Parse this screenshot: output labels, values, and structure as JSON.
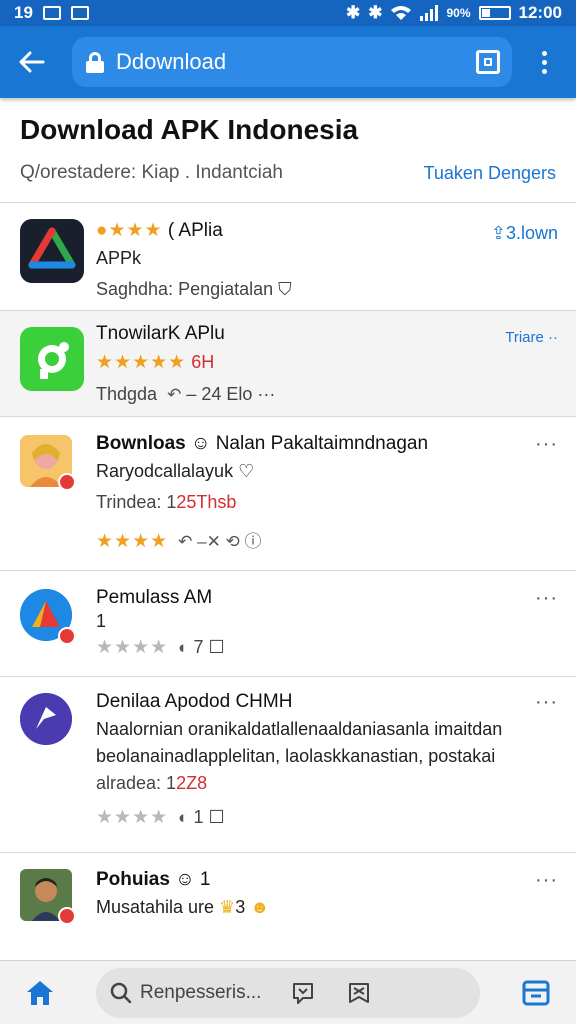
{
  "status_bar": {
    "time_left": "19",
    "battery": "90%",
    "time": "12:00"
  },
  "app_bar": {
    "url": "Ddownload"
  },
  "header": {
    "title": "Download APK Indonesia",
    "subtitle": "Q/orestadere: Kiap . Indantciah",
    "link": "Tuaken Dengers"
  },
  "items": [
    {
      "rating_prefix": "( APlia",
      "line1": "APPk",
      "meta": "Saghdha: Pengiatalan",
      "action": "3.lown"
    },
    {
      "title": "TnowilarK APlu",
      "rating_value": "6H",
      "meta": "Thdgda",
      "meta_extra": "– 24",
      "meta_tail": "Elo ···",
      "action": "Triare ··"
    },
    {
      "title": "Bownloas",
      "title_rest": "Nalan Pakaltaimndnagan",
      "line1": "Raryodcallalayuk",
      "meta_label": "Trindea: 1",
      "meta_value": "25Thsb",
      "more": "···"
    },
    {
      "title": "Pemulass AM",
      "line1": "1",
      "rating_count": "7",
      "more": "···"
    },
    {
      "title": "Denilaa Apodod CHMH",
      "line1": "Naalornian oranikaldatlallenaaldaniasanla imaitdan",
      "line2": "beolanainadlapplelitan, laolaskkanastian, postakai",
      "meta_label": "alradea: 1",
      "meta_value": "2Z8",
      "rating_count": "1",
      "more": "···"
    },
    {
      "title": "Pohuias",
      "title_rest": "1",
      "line1": "Musatahila ure",
      "line1_rest": "3",
      "more": "···"
    }
  ],
  "bottom_bar": {
    "search_placeholder": "Renpesseris..."
  },
  "colors": {
    "primary": "#1976d2",
    "status_bar": "#1565c0",
    "star": "#f0a020",
    "accent_red": "#d32f2f"
  }
}
